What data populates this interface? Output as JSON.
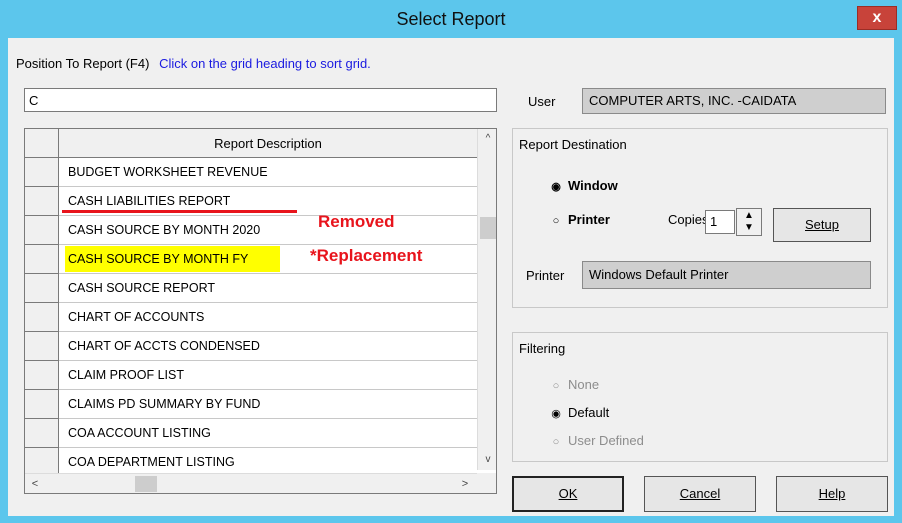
{
  "window": {
    "title": "Select Report",
    "close_label": "x"
  },
  "position": {
    "label": "Position To Report (F4)",
    "hint": "Click on the grid heading to sort grid.",
    "value": "C"
  },
  "grid": {
    "header": "Report Description",
    "rows": [
      "BUDGET WORKSHEET REVENUE",
      "CASH LIABILITIES REPORT",
      "CASH SOURCE BY MONTH 2020",
      "CASH SOURCE BY MONTH FY",
      "CASH SOURCE REPORT",
      "CHART OF ACCOUNTS",
      "CHART OF ACCTS CONDENSED",
      "CLAIM PROOF LIST",
      "CLAIMS PD SUMMARY BY FUND",
      "COA ACCOUNT LISTING",
      "COA DEPARTMENT LISTING"
    ],
    "scroll_up": "^",
    "scroll_down": "v",
    "scroll_left": "<",
    "scroll_right": ">"
  },
  "annotations": {
    "removed": "Removed",
    "replacement": "*Replacement",
    "color": "#e8141c",
    "highlight_color": "#ffff00"
  },
  "user": {
    "label": "User",
    "value": "COMPUTER ARTS, INC. -CAIDATA"
  },
  "destination": {
    "title": "Report Destination",
    "window_label": "Window",
    "printer_label": "Printer",
    "selected": "Window",
    "copies_label": "Copies",
    "copies_value": "1",
    "setup_label": "Setup",
    "printer_field_label": "Printer",
    "printer_value": "Windows Default Printer"
  },
  "filtering": {
    "title": "Filtering",
    "options": [
      "None",
      "Default",
      "User Defined"
    ],
    "selected": "Default"
  },
  "buttons": {
    "ok": "OK",
    "cancel": "Cancel",
    "help": "Help"
  },
  "colors": {
    "titlebar": "#5cc6ec",
    "close": "#c8433a",
    "hint": "#1a1ae0"
  }
}
